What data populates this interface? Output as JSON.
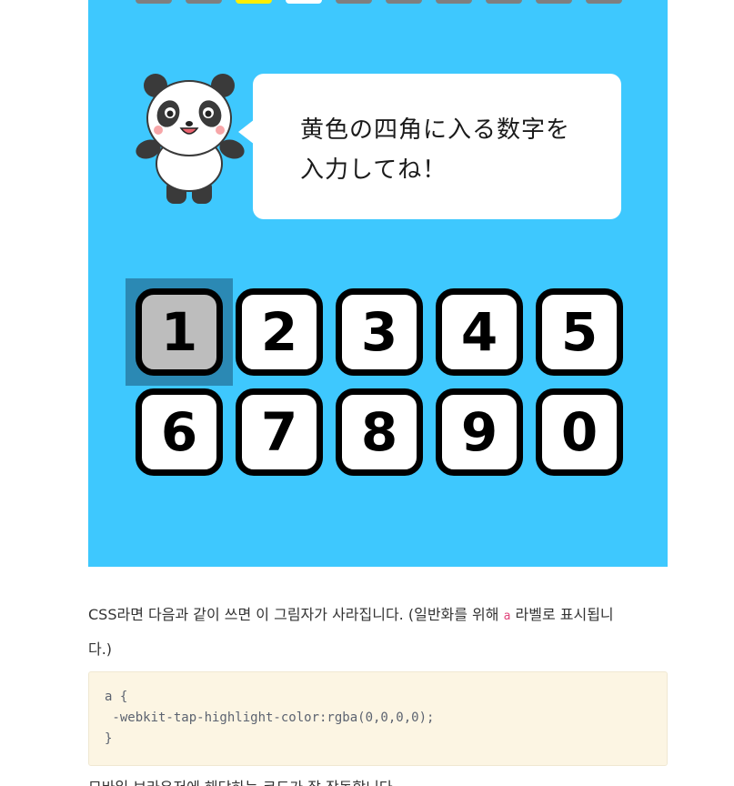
{
  "quiz": {
    "progress": [
      "done-dim",
      "done-dim",
      "current",
      "filled",
      "empty",
      "empty",
      "empty",
      "empty",
      "empty",
      "empty"
    ],
    "speech": {
      "line1": "黄色の四角に入る数字を",
      "line2": "入力してね！"
    },
    "keys": [
      "1",
      "2",
      "3",
      "4",
      "5",
      "6",
      "7",
      "8",
      "9",
      "0"
    ],
    "pressed_key": "1",
    "colors": {
      "background": "#3ec8fe",
      "current_slot": "#ffee00",
      "empty_slot": "#7f7f7f",
      "pressed_key": "#bdbdbd"
    }
  },
  "article": {
    "paragraph_before": "CSS라면 다음과 같이 쓰면 이 그림자가 사라집니다. (일반화를 위해 ",
    "inline_code": "a",
    "paragraph_after_line1": " 라벨로 표시됩니",
    "paragraph_after_line2": "다.)",
    "code": "a {\n -webkit-tap-highlight-color:rgba(0,0,0,0);\n}",
    "next_line": "모바일 브라우저에 해당하는 코드가 잘 작동합니다."
  }
}
